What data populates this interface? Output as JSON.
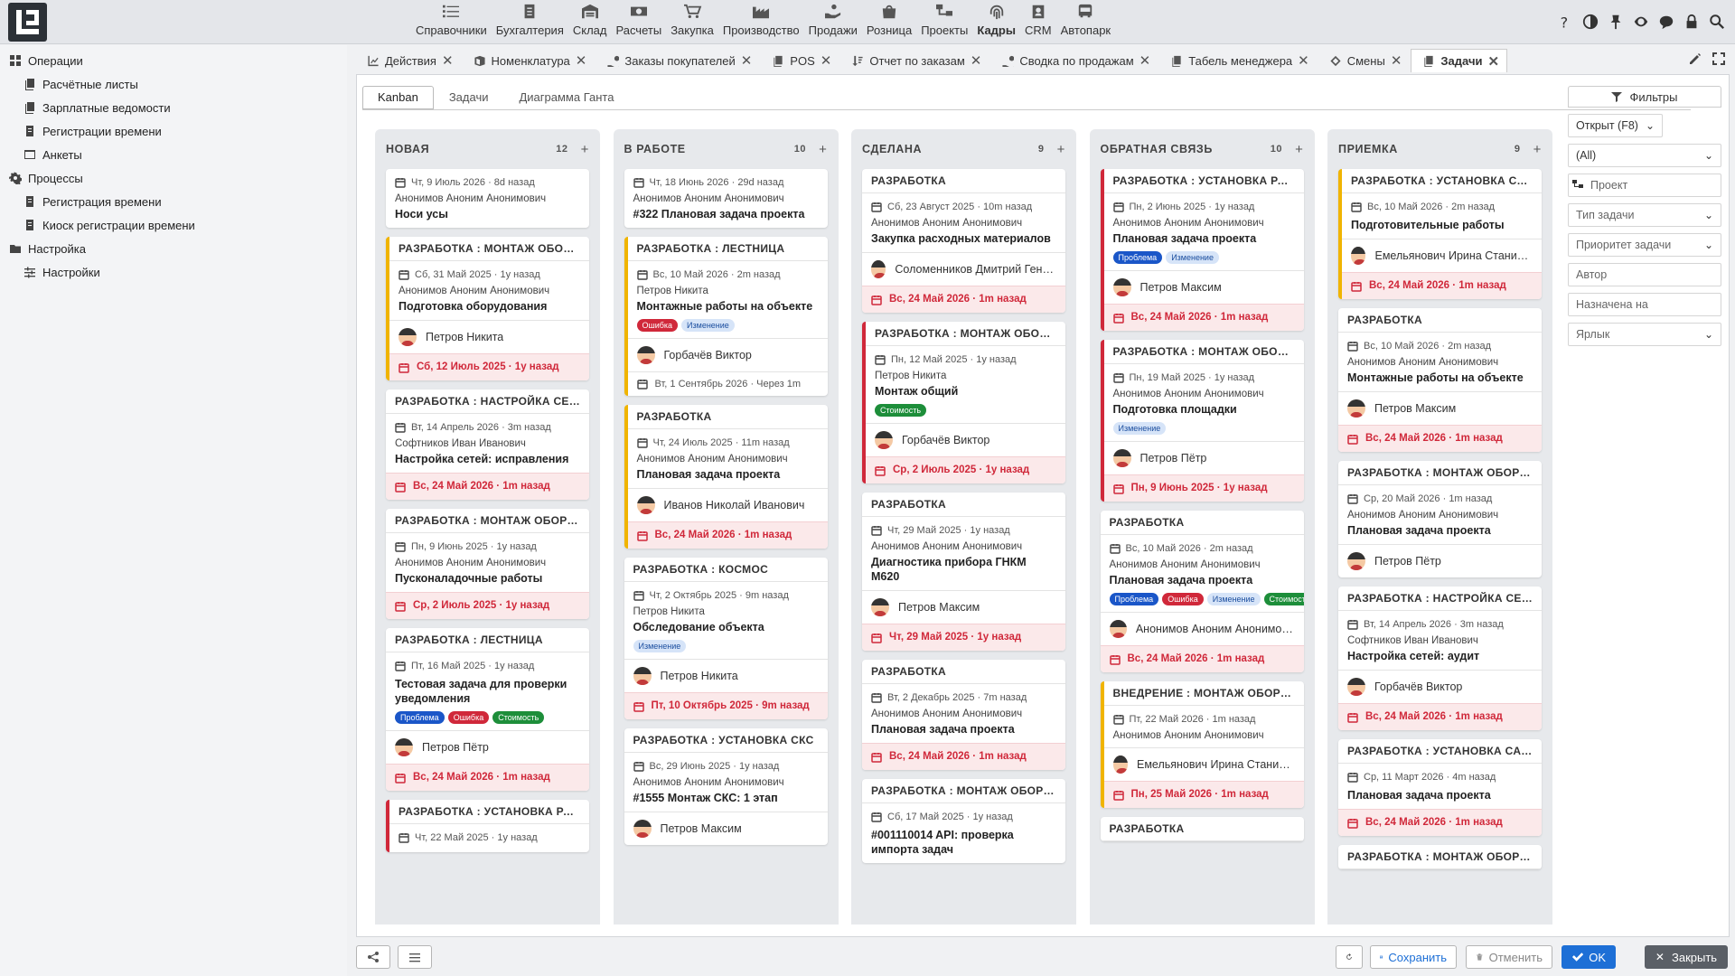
{
  "topmenu": [
    {
      "label": "Справочники",
      "icon": "list-icon"
    },
    {
      "label": "Бухгалтерия",
      "icon": "ledger-icon"
    },
    {
      "label": "Склад",
      "icon": "warehouse-icon"
    },
    {
      "label": "Расчеты",
      "icon": "money-icon"
    },
    {
      "label": "Закупка",
      "icon": "cart-icon"
    },
    {
      "label": "Производство",
      "icon": "factory-icon"
    },
    {
      "label": "Продажи",
      "icon": "hand-coin-icon"
    },
    {
      "label": "Розница",
      "icon": "shop-bag-icon"
    },
    {
      "label": "Проекты",
      "icon": "project-icon"
    },
    {
      "label": "Кадры",
      "icon": "fingerprint-icon",
      "active": true
    },
    {
      "label": "CRM",
      "icon": "crm-icon"
    },
    {
      "label": "Автопарк",
      "icon": "bus-icon"
    }
  ],
  "sidebar": [
    {
      "label": "Операции",
      "level": 0,
      "icon": "grid-icon"
    },
    {
      "label": "Расчётные листы",
      "level": 1,
      "icon": "docs-icon"
    },
    {
      "label": "Зарплатные ведомости",
      "level": 1,
      "icon": "docs-icon"
    },
    {
      "label": "Регистрации времени",
      "level": 1,
      "icon": "doc-icon"
    },
    {
      "label": "Анкеты",
      "level": 1,
      "icon": "form-icon"
    },
    {
      "label": "Процессы",
      "level": 0,
      "icon": "gear-icon"
    },
    {
      "label": "Регистрация времени",
      "level": 1,
      "icon": "doc-icon"
    },
    {
      "label": "Киоск регистрации времени",
      "level": 1,
      "icon": "doc-icon"
    },
    {
      "label": "Настройка",
      "level": 0,
      "icon": "folder-icon"
    },
    {
      "label": "Настройки",
      "level": 1,
      "icon": "sliders-icon"
    }
  ],
  "tabs": [
    {
      "label": "Действия",
      "icon": "chart-icon"
    },
    {
      "label": "Номенклатура",
      "icon": "box-icon"
    },
    {
      "label": "Заказы покупателей",
      "icon": "hand-coin-icon"
    },
    {
      "label": "POS",
      "icon": "docs-icon"
    },
    {
      "label": "Отчет по заказам",
      "icon": "sort-icon"
    },
    {
      "label": "Сводка по продажам",
      "icon": "hand-coin-icon"
    },
    {
      "label": "Табель менеджера",
      "icon": "docs-icon"
    },
    {
      "label": "Смены",
      "icon": "diamond-icon"
    },
    {
      "label": "Задачи",
      "icon": "docs-icon",
      "active": true
    }
  ],
  "subtabs": [
    {
      "label": "Kanban",
      "active": true
    },
    {
      "label": "Задачи"
    },
    {
      "label": "Диаграмма Ганта"
    }
  ],
  "filters": {
    "header": "Фильтры",
    "state": "Открыт (F8)",
    "all": "(All)",
    "project": "Проект",
    "task_type": "Тип задачи",
    "priority": "Приоритет задачи",
    "author": "Автор",
    "assigned": "Назначена на",
    "label": "Ярлык"
  },
  "columns": [
    {
      "title": "НОВАЯ",
      "count": "12",
      "cards": [
        {
          "border": "none",
          "date": "Чт, 9 Июль 2026 · 8d назад",
          "author": "Анонимов Аноним Анонимович",
          "title": "Носи усы"
        },
        {
          "border": "yellow",
          "header": "РАЗРАБОТКА : МОНТАЖ ОБОРУДОВАНИЯ",
          "date": "Сб, 31 Май 2025 · 1y назад",
          "author": "Анонимов Аноним Анонимович",
          "title": "Подготовка оборудования",
          "assignee": "Петров Никита",
          "due": "Сб, 12 Июль 2025 · 1y назад"
        },
        {
          "border": "none",
          "header": "РАЗРАБОТКА : НАСТРОЙКА СЕТЕЙ",
          "date": "Вт, 14 Апрель 2026 · 3m назад",
          "author": "Софтников Иван Иванович",
          "title": "Настройка сетей: исправления",
          "due": "Вс, 24 Май 2026 · 1m назад"
        },
        {
          "border": "none",
          "header": "РАЗРАБОТКА : МОНТАЖ ОБОРУДОВАНИЯ",
          "date": "Пн, 9 Июнь 2025 · 1y назад",
          "author": "Анонимов Аноним Анонимович",
          "title": "Пусконаладочные работы",
          "due": "Ср, 2 Июль 2025 · 1y назад"
        },
        {
          "border": "none",
          "header": "РАЗРАБОТКА : ЛЕСТНИЦА",
          "date": "Пт, 16 Май 2025 · 1y назад",
          "title": "Тестовая задача для проверки уведомления",
          "tags": [
            {
              "t": "Проблема",
              "c": "blue"
            },
            {
              "t": "Ошибка",
              "c": "red"
            },
            {
              "t": "Стоимость",
              "c": "green"
            }
          ],
          "assignee": "Петров Пётр",
          "due": "Вс, 24 Май 2026 · 1m назад"
        },
        {
          "border": "red",
          "header": "РАЗРАБОТКА : УСТАНОВКА РАКОВИН",
          "date": "Чт, 22 Май 2025 · 1y назад"
        }
      ]
    },
    {
      "title": "В РАБОТЕ",
      "count": "10",
      "cards": [
        {
          "border": "none",
          "date": "Чт, 18 Июнь 2026 · 29d назад",
          "author": "Анонимов Аноним Анонимович",
          "title": "#322 Плановая задача проекта"
        },
        {
          "border": "yellow",
          "header": "РАЗРАБОТКА : ЛЕСТНИЦА",
          "date": "Вс, 10 Май 2026 · 2m назад",
          "author": "Петров Никита",
          "title": "Монтажные работы на объекте",
          "tags": [
            {
              "t": "Ошибка",
              "c": "red"
            },
            {
              "t": "Изменение",
              "c": "lb"
            }
          ],
          "assignee": "Горбачёв Виктор",
          "plain_due": "Вт, 1 Сентябрь 2026 · Через 1m"
        },
        {
          "border": "yellow",
          "header": "РАЗРАБОТКА",
          "date": "Чт, 24 Июль 2025 · 11m назад",
          "author": "Анонимов Аноним Анонимович",
          "title": "Плановая задача проекта",
          "assignee": "Иванов Николай Иванович",
          "due": "Вс, 24 Май 2026 · 1m назад"
        },
        {
          "border": "none",
          "header": "РАЗРАБОТКА : КОСМОС",
          "date": "Чт, 2 Октябрь 2025 · 9m назад",
          "author": "Петров Никита",
          "title": "Обследование объекта",
          "tags": [
            {
              "t": "Изменение",
              "c": "lb"
            }
          ],
          "assignee": "Петров Никита",
          "due": "Пт, 10 Октябрь 2025 · 9m назад"
        },
        {
          "border": "none",
          "header": "РАЗРАБОТКА : УСТАНОВКА СКС",
          "date": "Вс, 29 Июнь 2025 · 1y назад",
          "author": "Анонимов Аноним Анонимович",
          "title": "#1555 Монтаж СКС: 1 этап",
          "assignee": "Петров Максим"
        }
      ]
    },
    {
      "title": "СДЕЛАНА",
      "count": "9",
      "cards": [
        {
          "border": "none",
          "header": "РАЗРАБОТКА",
          "date": "Сб, 23 Август 2025 · 10m назад",
          "author": "Анонимов Аноним Анонимович",
          "title": "Закупка расходных материалов",
          "assignee": "Соломенников Дмитрий Геннадьевич",
          "due": "Вс, 24 Май 2026 · 1m назад"
        },
        {
          "border": "red",
          "header": "РАЗРАБОТКА : МОНТАЖ ОБОРУДОВАНИЯ",
          "date": "Пн, 12 Май 2025 · 1y назад",
          "author": "Петров Никита",
          "title": "Монтаж общий",
          "tags": [
            {
              "t": "Стоимость",
              "c": "green"
            }
          ],
          "assignee": "Горбачёв Виктор",
          "due": "Ср, 2 Июль 2025 · 1y назад"
        },
        {
          "border": "none",
          "header": "РАЗРАБОТКА",
          "date": "Чт, 29 Май 2025 · 1y назад",
          "author": "Анонимов Аноним Анонимович",
          "title": "Диагностика прибора ГНКМ М620",
          "assignee": "Петров Максим",
          "due": "Чт, 29 Май 2025 · 1y назад"
        },
        {
          "border": "none",
          "header": "РАЗРАБОТКА",
          "date": "Вт, 2 Декабрь 2025 · 7m назад",
          "author": "Анонимов Аноним Анонимович",
          "title": "Плановая задача проекта",
          "due": "Вс, 24 Май 2026 · 1m назад"
        },
        {
          "border": "none",
          "header": "РАЗРАБОТКА : МОНТАЖ ОБОРУДОВАНИЯ",
          "date": "Сб, 17 Май 2025 · 1y назад",
          "title": "#001110014 API: проверка импорта задач"
        }
      ]
    },
    {
      "title": "ОБРАТНАЯ СВЯЗЬ",
      "count": "10",
      "cards": [
        {
          "border": "red",
          "header": "РАЗРАБОТКА : УСТАНОВКА РАКОВИН",
          "date": "Пн, 2 Июнь 2025 · 1y назад",
          "author": "Анонимов Аноним Анонимович",
          "title": "Плановая задача проекта",
          "tags": [
            {
              "t": "Проблема",
              "c": "blue"
            },
            {
              "t": "Изменение",
              "c": "lb"
            }
          ],
          "assignee": "Петров Максим",
          "due": "Вс, 24 Май 2026 · 1m назад"
        },
        {
          "border": "red",
          "header": "РАЗРАБОТКА : МОНТАЖ ОБОРУДОВАНИЯ",
          "date": "Пн, 19 Май 2025 · 1y назад",
          "author": "Анонимов Аноним Анонимович",
          "title": "Подготовка площадки",
          "tags": [
            {
              "t": "Изменение",
              "c": "lb"
            }
          ],
          "assignee": "Петров Пётр",
          "due": "Пн, 9 Июнь 2025 · 1y назад"
        },
        {
          "border": "none",
          "header": "РАЗРАБОТКА",
          "date": "Вс, 10 Май 2026 · 2m назад",
          "author": "Анонимов Аноним Анонимович",
          "title": "Плановая задача проекта",
          "tags": [
            {
              "t": "Проблема",
              "c": "blue"
            },
            {
              "t": "Ошибка",
              "c": "red"
            },
            {
              "t": "Изменение",
              "c": "lb"
            },
            {
              "t": "Стоимость",
              "c": "green"
            }
          ],
          "assignee": "Анонимов Аноним Анонимович",
          "due": "Вс, 24 Май 2026 · 1m назад"
        },
        {
          "border": "yellow",
          "header": "ВНЕДРЕНИЕ : МОНТАЖ ОБОРУДОВАНИЯ",
          "date": "Пт, 22 Май 2026 · 1m назад",
          "author": "Анонимов Аноним Анонимович",
          "assignee": "Емельянович Ирина Станиславовна",
          "due": "Пн, 25 Май 2026 · 1m назад"
        },
        {
          "border": "none",
          "header": "РАЗРАБОТКА"
        }
      ]
    },
    {
      "title": "ПРИЕМКА",
      "count": "9",
      "cards": [
        {
          "border": "yellow",
          "header": "РАЗРАБОТКА : УСТАНОВКА САНТЕХНИКИ",
          "date": "Вс, 10 Май 2026 · 2m назад",
          "title": "Подготовительные работы",
          "assignee": "Емельянович Ирина Станиславовна",
          "due": "Вс, 24 Май 2026 · 1m назад"
        },
        {
          "border": "none",
          "header": "РАЗРАБОТКА",
          "date": "Вс, 10 Май 2026 · 2m назад",
          "author": "Анонимов Аноним Анонимович",
          "title": "Монтажные работы на объекте",
          "assignee": "Петров Максим",
          "due": "Вс, 24 Май 2026 · 1m назад"
        },
        {
          "border": "none",
          "header": "РАЗРАБОТКА : МОНТАЖ ОБОРУДОВАНИЯ",
          "date": "Ср, 20 Май 2026 · 1m назад",
          "author": "Анонимов Аноним Анонимович",
          "title": "Плановая задача проекта",
          "assignee": "Петров Пётр"
        },
        {
          "border": "none",
          "header": "РАЗРАБОТКА : НАСТРОЙКА СЕТЕЙ",
          "date": "Вт, 14 Апрель 2026 · 3m назад",
          "author": "Софтников Иван Иванович",
          "title": "Настройка сетей: аудит",
          "assignee": "Горбачёв Виктор",
          "due": "Вс, 24 Май 2026 · 1m назад"
        },
        {
          "border": "none",
          "header": "РАЗРАБОТКА : УСТАНОВКА САНТЕХНИКИ",
          "date": "Ср, 11 Март 2026 · 4m назад",
          "title": "Плановая задача проекта",
          "due": "Вс, 24 Май 2026 · 1m назад"
        },
        {
          "border": "none",
          "header": "РАЗРАБОТКА : МОНТАЖ ОБОРУДОВАНИЯ"
        }
      ]
    }
  ],
  "bottom": {
    "save": "Сохранить",
    "cancel": "Отменить",
    "ok": "OK",
    "close": "Закрыть"
  }
}
